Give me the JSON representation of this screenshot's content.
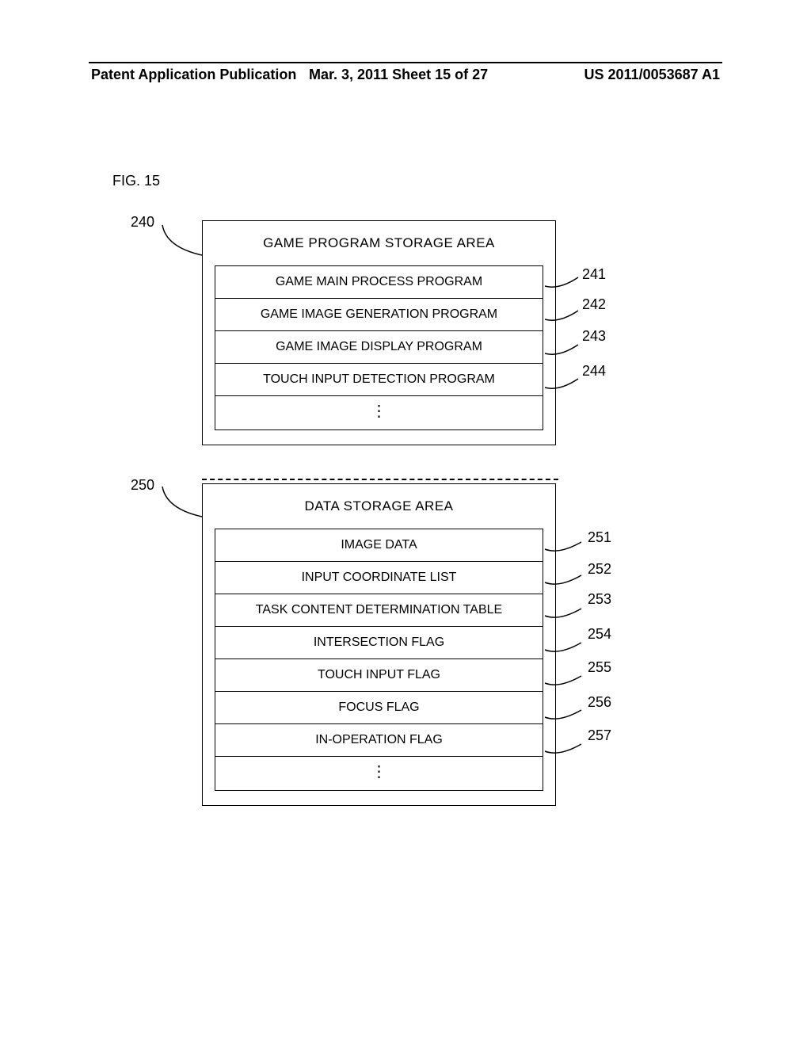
{
  "header": {
    "left": "Patent Application Publication",
    "center": "Mar. 3, 2011  Sheet 15 of 27",
    "right": "US 2011/0053687 A1"
  },
  "figure_label": "FIG. 15",
  "area1": {
    "ref": "240",
    "title": "GAME PROGRAM STORAGE AREA",
    "rows": [
      {
        "label": "GAME MAIN PROCESS PROGRAM",
        "ref": "241"
      },
      {
        "label": "GAME IMAGE GENERATION PROGRAM",
        "ref": "242"
      },
      {
        "label": "GAME IMAGE DISPLAY PROGRAM",
        "ref": "243"
      },
      {
        "label": "TOUCH INPUT DETECTION PROGRAM",
        "ref": "244"
      }
    ],
    "ellipsis": "⋮"
  },
  "area2": {
    "ref": "250",
    "title": "DATA STORAGE AREA",
    "rows": [
      {
        "label": "IMAGE DATA",
        "ref": "251"
      },
      {
        "label": "INPUT COORDINATE LIST",
        "ref": "252"
      },
      {
        "label": "TASK CONTENT DETERMINATION TABLE",
        "ref": "253"
      },
      {
        "label": "INTERSECTION FLAG",
        "ref": "254"
      },
      {
        "label": "TOUCH INPUT FLAG",
        "ref": "255"
      },
      {
        "label": "FOCUS FLAG",
        "ref": "256"
      },
      {
        "label": "IN-OPERATION FLAG",
        "ref": "257"
      }
    ],
    "ellipsis": "⋮"
  }
}
